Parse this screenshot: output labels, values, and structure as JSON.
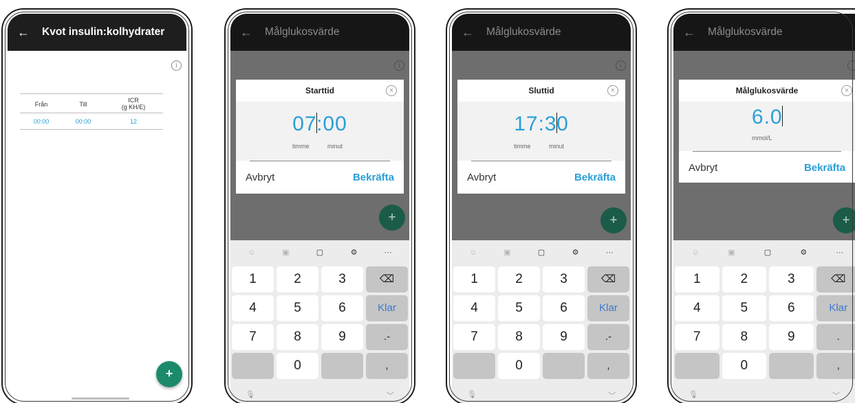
{
  "screen1": {
    "title": "Kvot insulin:kolhydrater",
    "back_icon": "←",
    "info_icon": "i",
    "table": {
      "headers": [
        "Från",
        "Till",
        "ICR",
        "(g KH/E)"
      ],
      "rows": [
        [
          "00:00",
          "00:00",
          "12"
        ]
      ]
    },
    "fab_label": "+"
  },
  "screen2": {
    "title": "Målglukosvärde",
    "dialog_title": "Starttid",
    "value_left": "07",
    "value_right": ":00",
    "unit_left": "timme",
    "unit_right": "minut",
    "cancel": "Avbryt",
    "confirm": "Bekräfta"
  },
  "screen3": {
    "title": "Målglukosvärde",
    "dialog_title": "Sluttid",
    "value_left": "17:3",
    "value_right": "0",
    "unit_left": "timme",
    "unit_right": "minut",
    "cancel": "Avbryt",
    "confirm": "Bekräfta"
  },
  "screen4": {
    "title": "Målglukosvärde",
    "dialog_title": "Målglukosvärde",
    "value": "6.0",
    "unit": "mmol/L",
    "cancel": "Avbryt",
    "confirm": "Bekräfta"
  },
  "keyboard": {
    "toolbar_icons": [
      "emoji-icon",
      "sticker-icon",
      "clipboard-icon",
      "settings-icon",
      "more-icon"
    ],
    "toolbar_more": "···",
    "keys_time": [
      "1",
      "2",
      "3",
      "⌫",
      "4",
      "5",
      "6",
      "Klar",
      "7",
      "8",
      "9",
      ".-",
      "",
      "0",
      "",
      ","
    ],
    "keys_decimal": [
      "1",
      "2",
      "3",
      "⌫",
      "4",
      "5",
      "6",
      "Klar",
      "7",
      "8",
      "9",
      ".",
      "",
      "0",
      "",
      ","
    ],
    "mic_icon": "mic-icon",
    "hide_icon": "chevron-down-icon"
  },
  "colors": {
    "accent_blue": "#2a9fd8",
    "fab_green": "#1b8a6b",
    "appbar": "#1e1e1e",
    "klar_blue": "#3a79d0"
  }
}
